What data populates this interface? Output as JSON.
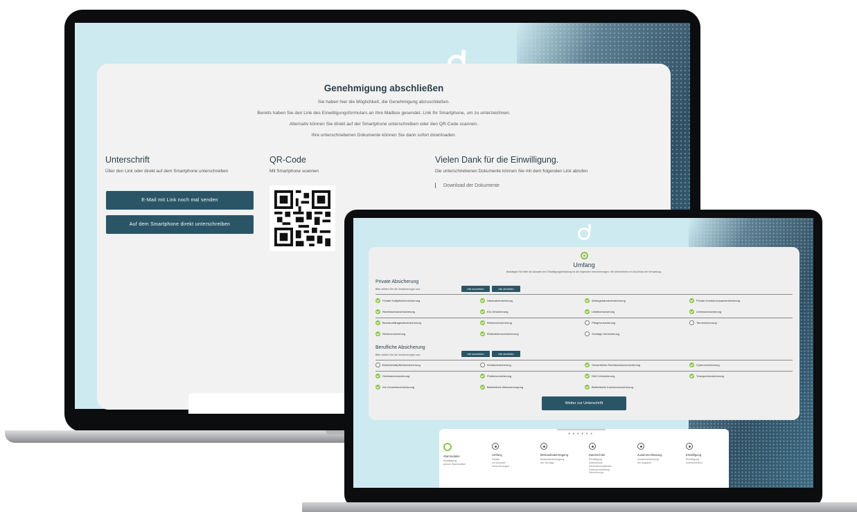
{
  "big_screen": {
    "logo_icon": "brand-logo-icon",
    "title": "Genehmigung abschließen",
    "description_lines": [
      "Sie haben hier die Möglichkeit, die Genehmigung abzuschließen.",
      "Bereits haben Sie den Link des Einwilligungsformulars an Ihre Mailbox gesendet. Link Ihr Smartphone, um zu unterzeichnen.",
      "Alternativ können Sie direkt auf der Smartphone unterschreiben oder den QR-Code scannen.",
      "Ihre unterschriebenen Dokumente können Sie dann sofort downloaden."
    ],
    "signature": {
      "heading": "Unterschrift",
      "subtext": "Über den Link oder direkt auf dem Smartphone unterschreiben",
      "email_button": "E-Mail mit Link noch mal senden",
      "phone_button": "Auf dem Smartphone direkt unterschreiben"
    },
    "qr": {
      "heading": "QR-Code",
      "subtext": "Mit Smartphone scannen"
    },
    "thanks": {
      "heading": "Vielen Dank für die Einwilligung.",
      "subtext": "Die unterschriebenen Dokumente können Sie mit dem folgenden Link abrufen",
      "download_link": "Download der Dokumente"
    }
  },
  "small_screen": {
    "title": "Umfang",
    "subtitle": "Bestätigen Sie bitte die Auswahl der Einwilligungserklärung für die folgenden Versicherungen. Wir übernehmen im Anschluss die Verwaltung.",
    "private": {
      "heading": "Private Absicherung",
      "subtext": "Bitte wählen Sie die Versicherungen aus",
      "btn_select_all": "Alle auswählen",
      "btn_deselect_all": "Alle abwählen",
      "items": [
        {
          "label": "Private Haftpflichtversicherung",
          "checked": true
        },
        {
          "label": "Hausratversicherung",
          "checked": true
        },
        {
          "label": "Wohngebäudeversicherung",
          "checked": true
        },
        {
          "label": "Private Krankenzusatzversicherung",
          "checked": true
        },
        {
          "label": "Rechtsschutzversicherung",
          "checked": true
        },
        {
          "label": "Kfz-Versicherung",
          "checked": true
        },
        {
          "label": "Unfallversicherung",
          "checked": true
        },
        {
          "label": "Lebensversicherung",
          "checked": true
        },
        {
          "label": "Berufsunfähigkeitsversicherung",
          "checked": true
        },
        {
          "label": "Rentenversicherung",
          "checked": true
        },
        {
          "label": "Pflegeversicherung",
          "checked": false
        },
        {
          "label": "Tierversicherung",
          "checked": false
        },
        {
          "label": "Reiseversicherung",
          "checked": true
        },
        {
          "label": "Risikolebensversicherung",
          "checked": true
        },
        {
          "label": "Sonstige Versicherung",
          "checked": false
        }
      ]
    },
    "business": {
      "heading": "Berufliche Absicherung",
      "subtext": "Bitte wählen Sie die Versicherungen aus",
      "btn_select_all": "Alle auswählen",
      "btn_deselect_all": "Alle abwählen",
      "items": [
        {
          "label": "Betriebshaftpflichtversicherung",
          "checked": false
        },
        {
          "label": "Inhaltsversicherung",
          "checked": false
        },
        {
          "label": "Gewerbliche Rechtsschutzversicherung",
          "checked": true
        },
        {
          "label": "Cyberversicherung",
          "checked": true
        },
        {
          "label": "Gebäudeversicherung",
          "checked": true
        },
        {
          "label": "Flottenversicherung",
          "checked": true
        },
        {
          "label": "D&O-Versicherung",
          "checked": true
        },
        {
          "label": "Transportversicherung",
          "checked": true
        },
        {
          "label": "Kfz-Gewerbeversicherung",
          "checked": true
        },
        {
          "label": "Betriebliche Altersversorgung",
          "checked": true
        },
        {
          "label": "Betriebliche Krankenversicherung",
          "checked": true
        }
      ]
    },
    "submit_button": "Weiter zur Unterschrift",
    "pager_dots": "● ● ● ● ● ●",
    "steps": [
      {
        "title": "Stammdaten",
        "desc": "Bestätigung\nperson Stammdaten"
      },
      {
        "title": "Umfang",
        "desc": "Details\nzur Auswahl\nVersicherungen"
      },
      {
        "title": "Bestandsübertragung",
        "desc": "Bestandsübertragung\nder Verträge"
      },
      {
        "title": "Datenschutz",
        "desc": "Einwilligung\nDatenschutz\nInformationspflichten\nDatenverarbeitung\nVersicherung"
      },
      {
        "title": "Zusammenfassung",
        "desc": "Zusammenfassung\nder Angaben"
      },
      {
        "title": "Einwilligung",
        "desc": "Einwilligung\nunterschreiben"
      }
    ]
  }
}
